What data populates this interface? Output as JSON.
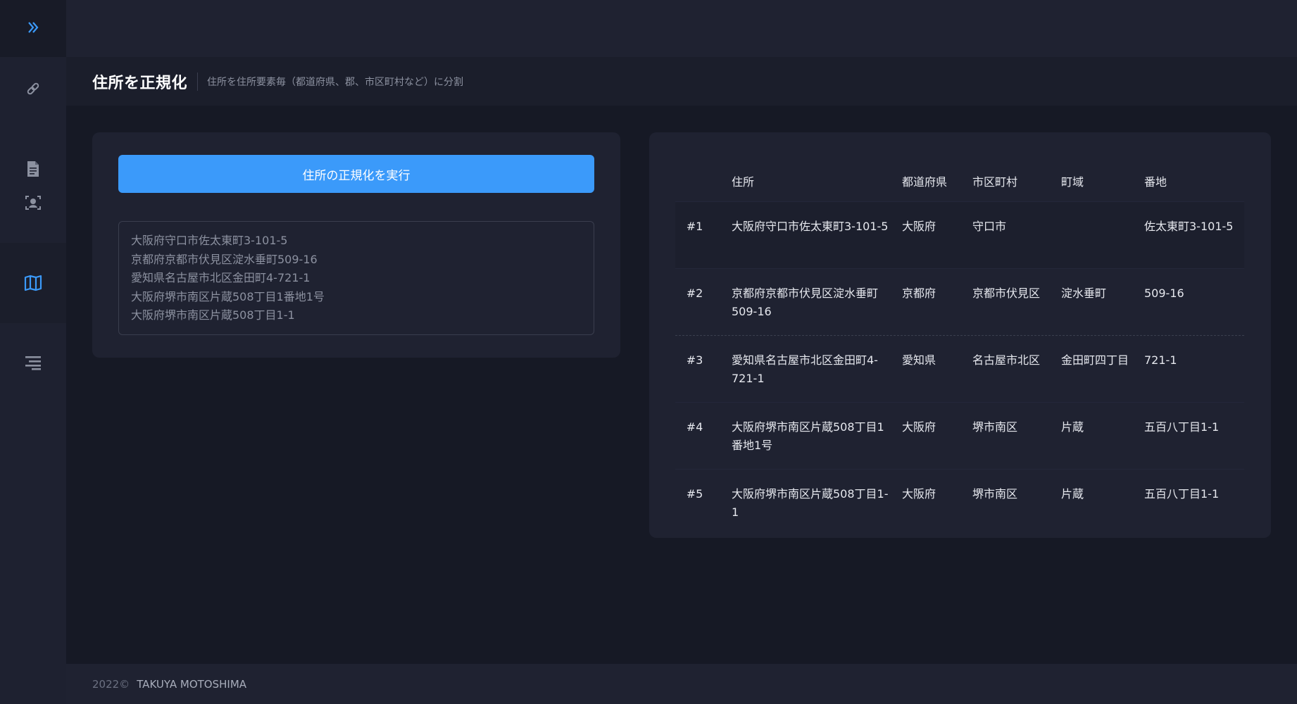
{
  "sidebar": {
    "toggle_icon": "double-chevron-right-icon",
    "items": [
      {
        "icon": "link-icon"
      },
      {
        "icon": "document-icon"
      },
      {
        "icon": "face-scan-icon"
      },
      {
        "icon": "map-icon",
        "active": true
      },
      {
        "icon": "text-align-icon"
      }
    ],
    "accent_color": "#3b9afa"
  },
  "header": {
    "title": "住所を正規化",
    "subtitle": "住所を住所要素毎（都道府県、郡、市区町村など）に分割"
  },
  "form": {
    "run_label": "住所の正規化を実行",
    "address_lines": [
      "大阪府守口市佐太東町3-101-5",
      "京都府京都市伏見区淀水垂町509-16",
      "愛知県名古屋市北区金田町4-721-1",
      "大阪府堺市南区片蔵508丁目1番地1号",
      "大阪府堺市南区片蔵508丁目1-1"
    ]
  },
  "table": {
    "headers": [
      "",
      "住所",
      "都道府県",
      "市区町村",
      "町域",
      "番地"
    ],
    "rows": [
      {
        "id": "#1",
        "address": "大阪府守口市佐太東町3-101-5",
        "prefecture": "大阪府",
        "city": "守口市",
        "town": "",
        "block": "佐太東町3-101-5"
      },
      {
        "id": "#2",
        "address": "京都府京都市伏見区淀水垂町509-16",
        "prefecture": "京都府",
        "city": "京都市伏見区",
        "town": "淀水垂町",
        "block": "509-16"
      },
      {
        "id": "#3",
        "address": "愛知県名古屋市北区金田町4-721-1",
        "prefecture": "愛知県",
        "city": "名古屋市北区",
        "town": "金田町四丁目",
        "block": "721-1"
      },
      {
        "id": "#4",
        "address": "大阪府堺市南区片蔵508丁目1番地1号",
        "prefecture": "大阪府",
        "city": "堺市南区",
        "town": "片蔵",
        "block": "五百八丁目1-1"
      },
      {
        "id": "#5",
        "address": "大阪府堺市南区片蔵508丁目1-1",
        "prefecture": "大阪府",
        "city": "堺市南区",
        "town": "片蔵",
        "block": "五百八丁目1-1"
      }
    ]
  },
  "footer": {
    "year": "2022©",
    "author": "TAKUYA MOTOSHIMA"
  }
}
